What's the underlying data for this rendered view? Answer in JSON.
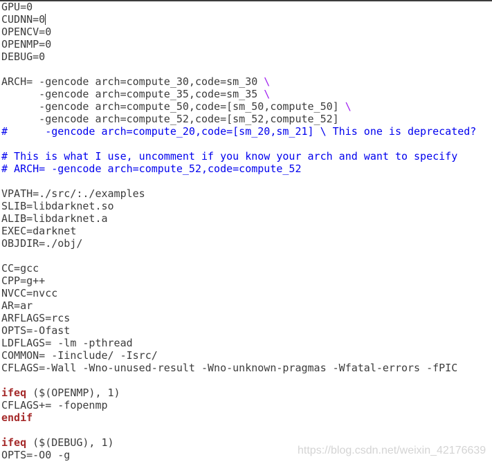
{
  "editor": {
    "cursor_line": 1,
    "colors": {
      "text": "#3c3c3c",
      "comment": "#0000ee",
      "keyword": "#a52a2a",
      "escape": "#a020f0"
    },
    "lines": [
      [
        [
          "GPU=0",
          "n"
        ]
      ],
      [
        [
          "CUDNN=0",
          "n"
        ]
      ],
      [
        [
          "OPENCV=0",
          "n"
        ]
      ],
      [
        [
          "OPENMP=0",
          "n"
        ]
      ],
      [
        [
          "DEBUG=0",
          "n"
        ]
      ],
      [],
      [
        [
          "ARCH= -gencode arch=compute_30,code=sm_30 ",
          "n"
        ],
        [
          "\\",
          "b"
        ]
      ],
      [
        [
          "      -gencode arch=compute_35,code=sm_35 ",
          "n"
        ],
        [
          "\\",
          "b"
        ]
      ],
      [
        [
          "      -gencode arch=compute_50,code=[sm_50,compute_50] ",
          "n"
        ],
        [
          "\\",
          "b"
        ]
      ],
      [
        [
          "      -gencode arch=compute_52,code=[sm_52,compute_52]",
          "n"
        ]
      ],
      [
        [
          "#      -gencode arch=compute_20,code=[sm_20,sm_21] \\ This one is deprecated?",
          "c"
        ]
      ],
      [],
      [
        [
          "# This is what I use, uncomment if you know your arch and want to specify",
          "c"
        ]
      ],
      [
        [
          "# ARCH= -gencode arch=compute_52,code=compute_52",
          "c"
        ]
      ],
      [],
      [
        [
          "VPATH=./src/:./examples",
          "n"
        ]
      ],
      [
        [
          "SLIB=libdarknet.so",
          "n"
        ]
      ],
      [
        [
          "ALIB=libdarknet.a",
          "n"
        ]
      ],
      [
        [
          "EXEC=darknet",
          "n"
        ]
      ],
      [
        [
          "OBJDIR=./obj/",
          "n"
        ]
      ],
      [],
      [
        [
          "CC=gcc",
          "n"
        ]
      ],
      [
        [
          "CPP=g++",
          "n"
        ]
      ],
      [
        [
          "NVCC=nvcc",
          "n"
        ]
      ],
      [
        [
          "AR=ar",
          "n"
        ]
      ],
      [
        [
          "ARFLAGS=rcs",
          "n"
        ]
      ],
      [
        [
          "OPTS=-Ofast",
          "n"
        ]
      ],
      [
        [
          "LDFLAGS= -lm -pthread",
          "n"
        ]
      ],
      [
        [
          "COMMON= -Iinclude/ -Isrc/",
          "n"
        ]
      ],
      [
        [
          "CFLAGS=-Wall -Wno-unused-result -Wno-unknown-pragmas -Wfatal-errors -fPIC",
          "n"
        ]
      ],
      [],
      [
        [
          "ifeq",
          "k"
        ],
        [
          " ($(OPENMP), 1)",
          "n"
        ]
      ],
      [
        [
          "CFLAGS+= -fopenmp",
          "n"
        ]
      ],
      [
        [
          "endif",
          "k"
        ]
      ],
      [],
      [
        [
          "ifeq",
          "k"
        ],
        [
          " ($(DEBUG), 1)",
          "n"
        ]
      ],
      [
        [
          "OPTS=-O0 -g",
          "n"
        ]
      ]
    ]
  },
  "watermark": "https://blog.csdn.net/weixin_42176639"
}
